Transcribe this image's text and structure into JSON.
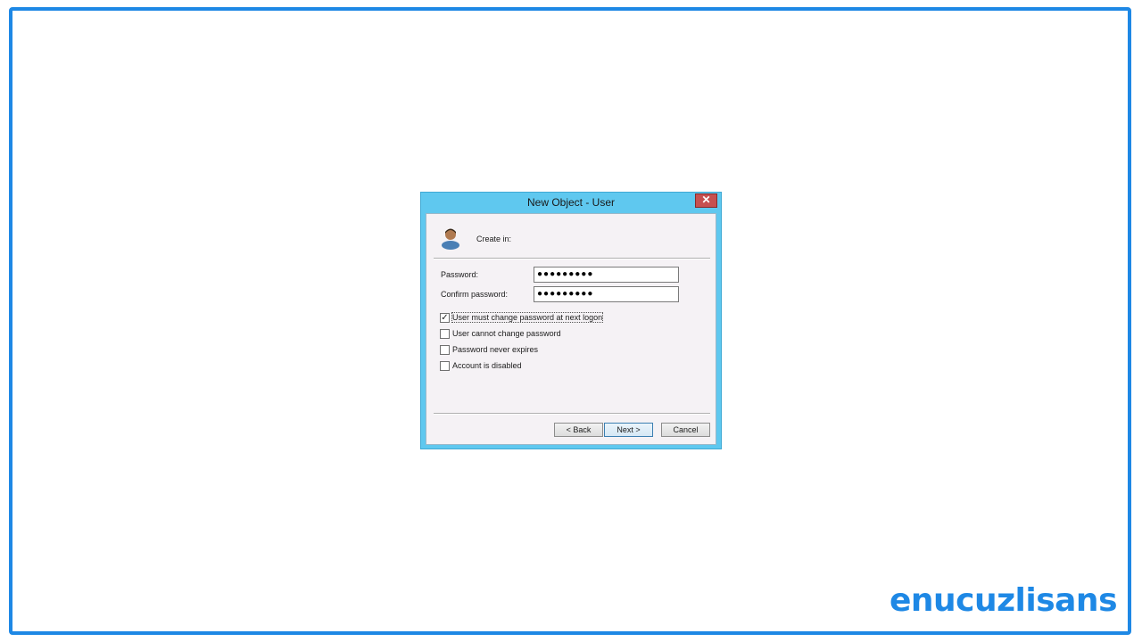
{
  "dialog": {
    "title": "New Object - User",
    "close_glyph": "✕",
    "create_in_label": "Create in:",
    "password_label": "Password:",
    "password_value": "●●●●●●●●●",
    "confirm_label": "Confirm password:",
    "confirm_value": "●●●●●●●●●",
    "options": [
      {
        "label": "User must change password at next logon",
        "checked": true
      },
      {
        "label": "User cannot change password",
        "checked": false
      },
      {
        "label": "Password never expires",
        "checked": false
      },
      {
        "label": "Account is disabled",
        "checked": false
      }
    ],
    "back_label": "< Back",
    "next_label": "Next >",
    "cancel_label": "Cancel"
  },
  "brand": {
    "text": "enucuzlisans"
  },
  "colors": {
    "frame": "#1e88e5",
    "titlebar": "#5fc8ef",
    "close": "#c75050",
    "brand": "#1e88e5"
  },
  "icons": {
    "user": "user-icon",
    "close": "close-icon",
    "check": "check-icon"
  }
}
